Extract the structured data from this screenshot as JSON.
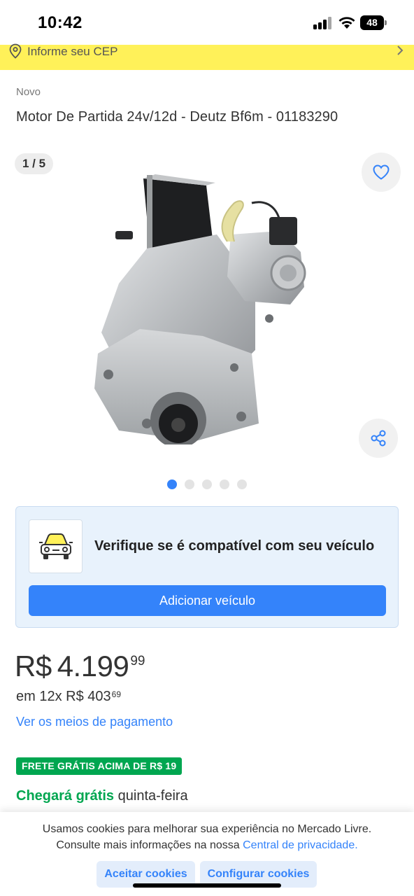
{
  "status_bar": {
    "time": "10:42",
    "battery": "48"
  },
  "location_bar": {
    "label": "Informe seu CEP"
  },
  "product": {
    "condition": "Novo",
    "title": "Motor De Partida 24v/12d - Deutz Bf6m - 01183290",
    "image_counter": "1 / 5",
    "image_count": 5,
    "current_image": 1
  },
  "compatibility": {
    "message": "Verifique se é compatível com seu veículo",
    "button_label": "Adicionar veículo"
  },
  "price": {
    "currency": "R$",
    "amount": "4.199",
    "cents": "99",
    "installments_prefix": "em 12x R$ 403",
    "installments_cents": "69",
    "payment_link": "Ver os meios de pagamento"
  },
  "shipping": {
    "badge": "FRETE GRÁTIS ACIMA DE R$ 19",
    "arrival_highlight": "Chegará grátis",
    "arrival_day": "quinta-feira"
  },
  "cookies": {
    "line1": "Usamos cookies para melhorar sua experiência no Mercado Livre.",
    "line2_prefix": "Consulte mais informações na nossa",
    "line2_link": "Central de privacidade.",
    "accept_label": "Aceitar cookies",
    "configure_label": "Configurar cookies"
  },
  "colors": {
    "accent_blue": "#3483fa",
    "brand_yellow": "#fff159",
    "success_green": "#00a650"
  }
}
